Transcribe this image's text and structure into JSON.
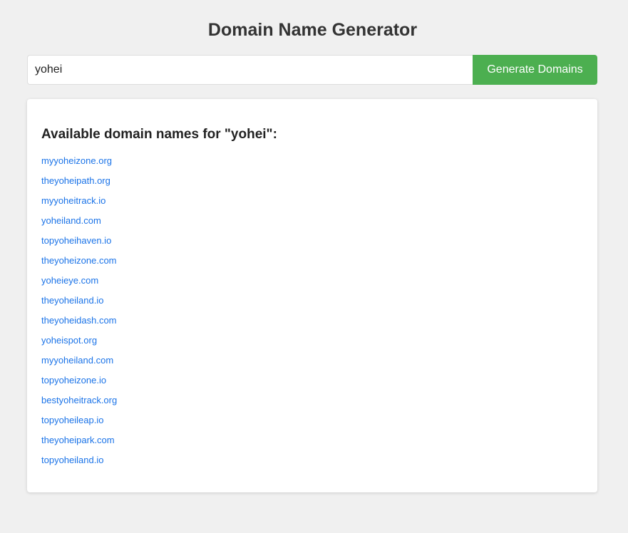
{
  "title": "Domain Name Generator",
  "search": {
    "value": "yohei",
    "button_label": "Generate Domains"
  },
  "results": {
    "heading": "Available domain names for \"yohei\":",
    "domains": [
      "myyoheizone.org",
      "theyoheipath.org",
      "myyoheitrack.io",
      "yoheiland.com",
      "topyoheihaven.io",
      "theyoheizone.com",
      "yoheieye.com",
      "theyoheiland.io",
      "theyoheidash.com",
      "yoheispot.org",
      "myyoheiland.com",
      "topyoheizone.io",
      "bestyoheitrack.org",
      "topyoheileap.io",
      "theyoheipark.com",
      "topyoheiland.io"
    ]
  },
  "colors": {
    "background": "#f0f0f0",
    "button": "#4caf50",
    "link": "#1a73e8"
  }
}
